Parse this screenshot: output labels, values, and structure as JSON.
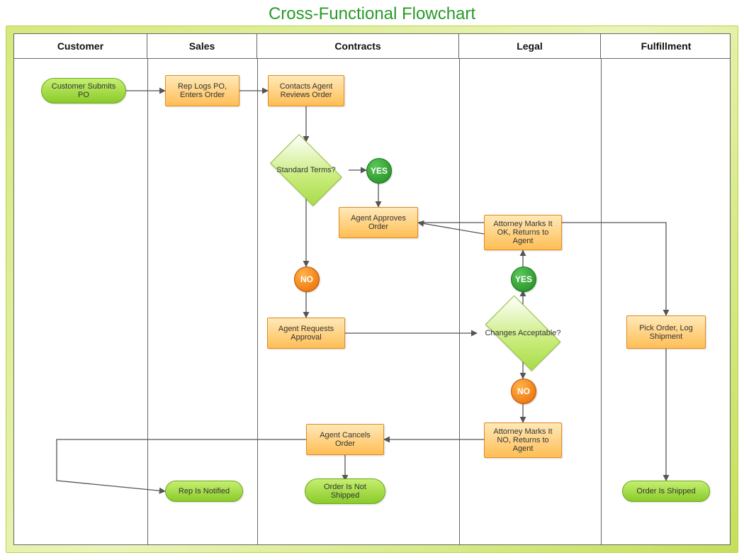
{
  "title": "Cross-Functional Flowchart",
  "lanes": {
    "customer": "Customer",
    "sales": "Sales",
    "contracts": "Contracts",
    "legal": "Legal",
    "fulfillment": "Fulfillment"
  },
  "nodes": {
    "customer_submits": "Customer Submits PO",
    "rep_logs": "Rep Logs PO, Enters Order",
    "contacts_reviews": "Contacts Agent Reviews Order",
    "standard_terms": "Standard Terms?",
    "agent_approves": "Agent Approves Order",
    "agent_requests": "Agent Requests Approval",
    "agent_cancels": "Agent Cancels Order",
    "changes_accept": "Changes Acceptable?",
    "attorney_ok": "Attorney Marks It OK, Returns to Agent",
    "attorney_no": "Attorney Marks It NO, Returns to Agent",
    "pick_order": "Pick Order, Log Shipment",
    "rep_notified": "Rep Is Notified",
    "not_shipped": "Order Is Not Shipped",
    "shipped": "Order Is Shipped"
  },
  "labels": {
    "yes": "YES",
    "no": "NO"
  }
}
